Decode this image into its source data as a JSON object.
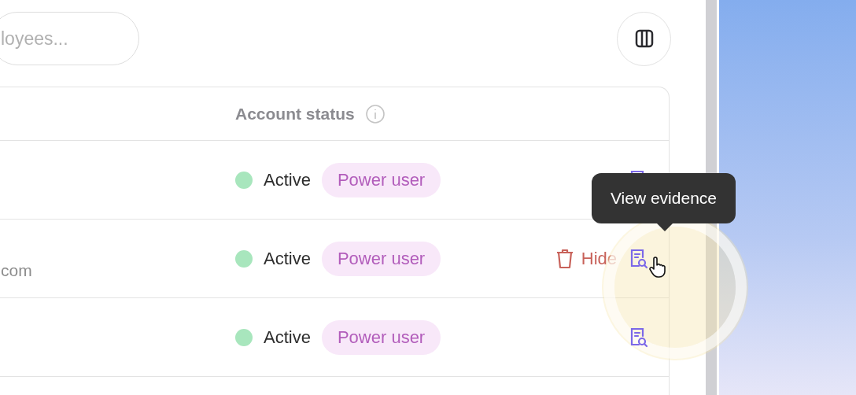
{
  "search": {
    "placeholder": "loyees..."
  },
  "table": {
    "columns": [
      {
        "label": "Account status"
      }
    ],
    "rows": [
      {
        "status": "Active",
        "color": "#a8e6bd",
        "role": "Power user"
      },
      {
        "email": "com",
        "status": "Active",
        "color": "#a8e6bd",
        "role": "Power user",
        "hide_label": "Hide",
        "hovered": true,
        "tooltip": "View evidence"
      },
      {
        "status": "Active",
        "color": "#a8e6bd",
        "role": "Power user"
      }
    ]
  }
}
